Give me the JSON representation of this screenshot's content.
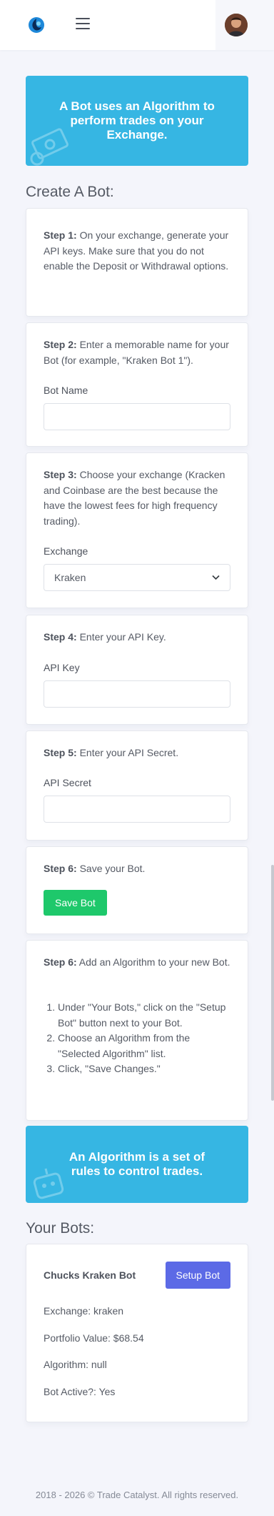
{
  "header": {
    "logo_icon": "droplet-logo-icon",
    "menu_icon": "hamburger-icon",
    "avatar_icon": "user-avatar"
  },
  "banner_top": {
    "text": "A Bot uses an Algorithm to perform trades on your Exchange."
  },
  "create_title": "Create A Bot:",
  "steps": {
    "s1": {
      "label": "Step 1:",
      "text": " On your exchange, generate your API keys. Make sure that you do not enable the Deposit or Withdrawal options."
    },
    "s2": {
      "label": "Step 2:",
      "text": " Enter a memorable name for your Bot (for example, \"Kraken Bot 1\").",
      "field_label": "Bot Name",
      "value": ""
    },
    "s3": {
      "label": "Step 3:",
      "text": " Choose your exchange (Kracken and Coinbase are the best because the have the lowest fees for high frequency trading).",
      "field_label": "Exchange",
      "selected": "Kraken"
    },
    "s4": {
      "label": "Step 4:",
      "text": " Enter your API Key.",
      "field_label": "API Key",
      "value": ""
    },
    "s5": {
      "label": "Step 5:",
      "text": " Enter your API Secret.",
      "field_label": "API Secret",
      "value": ""
    },
    "s6": {
      "label": "Step 6:",
      "text": " Save your Bot.",
      "button": "Save Bot"
    },
    "s7": {
      "label": "Step 6:",
      "text": " Add an Algorithm to your new Bot.",
      "list": [
        "Under \"Your Bots,\" click on the \"Setup Bot\" button next to your Bot.",
        "Choose an Algorithm from the \"Selected Algorithm\" list.",
        "Click, \"Save Changes.\""
      ]
    }
  },
  "banner_algo": {
    "text": "An Algorithm is a set of rules to control trades."
  },
  "bots_title": "Your Bots:",
  "bot": {
    "name": "Chucks Kraken Bot",
    "setup_button": "Setup Bot",
    "exchange": "Exchange: kraken",
    "portfolio": "Portfolio Value: $68.54",
    "algorithm": "Algorithm: null",
    "active": "Bot Active?: Yes"
  },
  "footer": "2018 - 2026 © Trade Catalyst. All rights reserved.",
  "colors": {
    "accent_blue": "#36b6e3",
    "save_green": "#1ec86b",
    "setup_purple": "#5c6ae6",
    "page_bg": "#f4f5fb"
  }
}
